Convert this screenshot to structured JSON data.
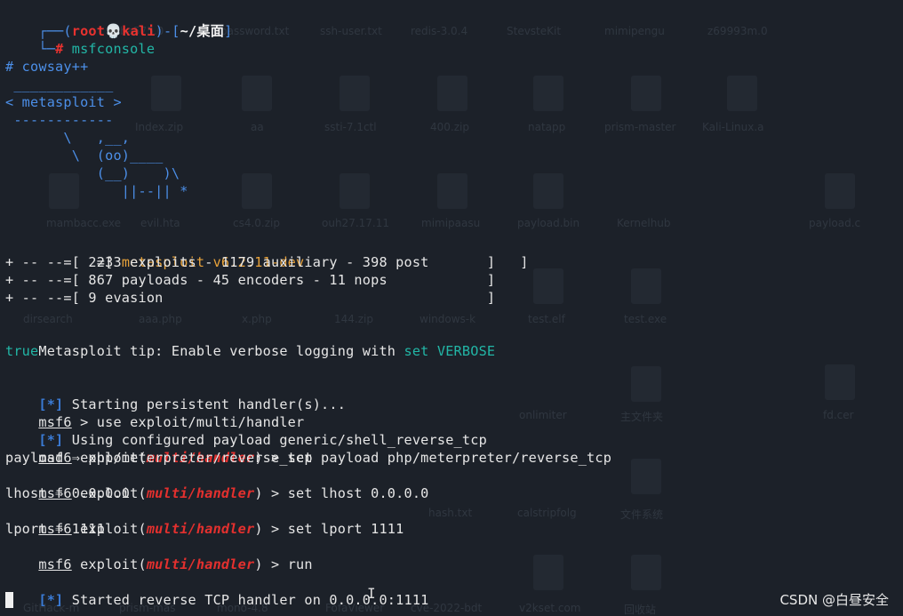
{
  "prompt": {
    "bracket_open": "┌──(",
    "user": "root",
    "skull": "💀",
    "host": "kali",
    "mid": ")-[",
    "path": "~/桌面",
    "bracket_close": "]",
    "corner": "└─",
    "hash": "#",
    "command": "msfconsole"
  },
  "cowsay": {
    "command": "# cowsay++",
    "top_rule": " ____________",
    "speech": "< metasploit >",
    "bottom_rule": " ------------",
    "cow1": "       \\   ,__,",
    "cow2": "        \\  (oo)____",
    "cow3": "           (__)    )\\",
    "cow4": "              ||--|| *"
  },
  "banner": {
    "line1_prefix": "       =[ ",
    "line1_version": "metasploit v6.2.11-dev",
    "line1_suffix": "                          ]",
    "line2": "+ -- --=[ 2233 exploits - 1179 auxiliary - 398 post       ]",
    "line3": "+ -- --=[ 867 payloads - 45 encoders - 11 nops            ]",
    "line4": "+ -- --=[ 9 evasion                                       ]"
  },
  "tip": {
    "prefix": "Metasploit tip: Enable verbose logging with ",
    "cmd": "set VERBOSE",
    "cmd2": "true"
  },
  "session": {
    "info_tag": "[*]",
    "msf": "msf6",
    "exploit_word": "exploit(",
    "module": "multi/handler",
    "close": ") > ",
    "l1": " Starting persistent handler(s)...",
    "l2_rest": " > use exploit/multi/handler",
    "l3": " Using configured payload generic/shell_reverse_tcp",
    "l4_cmd": "set payload php/meterpreter/reverse_tcp",
    "l5": "payload ⇒ php/meterpreter/reverse_tcp",
    "l6_cmd": "set lhost 0.0.0.0",
    "l7": "lhost ⇒ 0.0.0.0",
    "l8_cmd": "set lport 1111",
    "l9": "lport ⇒ 1111",
    "l10_cmd": "run",
    "l11": " Started reverse TCP handler on 0.0.0.0:1111"
  },
  "desktop": {
    "labels": [
      "a5ba575.0",
      "password.txt",
      "ssh-user.txt",
      "redis-3.0.4",
      "StevsteKit",
      "mimipengu",
      "z69993m.0",
      "Index.zip",
      "aa",
      "ssti-7.1ctl",
      "400.zip",
      "natapp",
      "prism-master",
      "Kali-Linux.a",
      "mambacc.exe",
      "evil.hta",
      "cs4.0.zip",
      "ouh27.17.11",
      "mimipaasu",
      "payload.bin",
      "Kernelhub",
      "payload.c",
      "dirsearch",
      "aaa.php",
      "x.php",
      "144.zip",
      "windows-k",
      "test.elf",
      "test.exe",
      "onlimiter",
      "主文件夹",
      "fd.cer",
      "hash.txt",
      "calstripfolg",
      "文件系统",
      "GitHack-m",
      "prism-mas",
      "mono-4.8",
      "FofaViewer",
      "cve-2022-bdt",
      "v2kset.com",
      "回收站"
    ],
    "watermark": "CSDN @白昼安全"
  },
  "colors": {
    "background": "#1c2129",
    "prompt_blue": "#4c8fe8",
    "prompt_red": "#e8322f",
    "teal": "#22b6a6",
    "orange": "#e8a23a"
  }
}
